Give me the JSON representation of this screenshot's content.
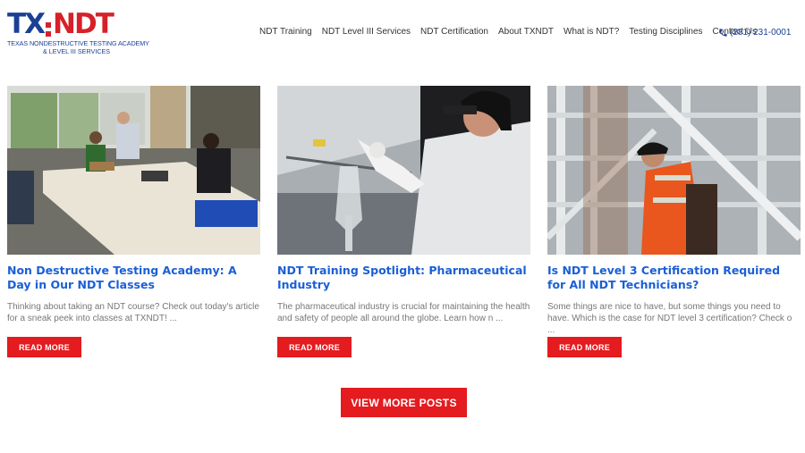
{
  "logo": {
    "mark_left": "TX",
    "mark_right": "NDT",
    "line1": "TEXAS NONDESTRUCTIVE TESTING ACADEMY",
    "line2": "& LEVEL III SERVICES"
  },
  "nav": {
    "items": [
      {
        "label": "NDT Training"
      },
      {
        "label": "NDT Level III Services"
      },
      {
        "label": "NDT Certification"
      },
      {
        "label": "About TXNDT"
      },
      {
        "label": "What is NDT?"
      },
      {
        "label": "Testing Disciplines"
      },
      {
        "label": "Contact Us"
      }
    ],
    "phone": "(281) 231-0001"
  },
  "posts": [
    {
      "title": "Non Destructive Testing Academy: A Day in Our NDT Classes",
      "excerpt": "Thinking about taking an NDT course? Check out today's article for a sneak peek into classes at TXNDT! ...",
      "button": "READ MORE"
    },
    {
      "title": "NDT Training Spotlight: Pharmaceutical Industry",
      "excerpt": "The pharmaceutical industry is crucial for maintaining the health and safety of people all around the globe. Learn how n ...",
      "button": "READ MORE"
    },
    {
      "title": "Is NDT Level 3 Certification Required for All NDT Technicians?",
      "excerpt": "Some things are nice to have, but some things you need to have. Which is the case for NDT level 3 certification? Check o ...",
      "button": "READ MORE"
    }
  ],
  "view_more": "VIEW MORE POSTS",
  "colors": {
    "brand_blue": "#1b3f94",
    "brand_red": "#d62128",
    "link_blue": "#1a5fd6",
    "button_red": "#e41b1f"
  }
}
